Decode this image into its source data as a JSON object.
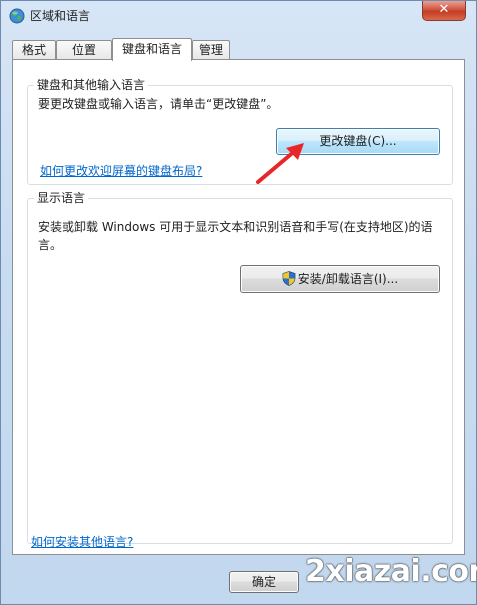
{
  "window": {
    "title": "区域和语言",
    "close_label": "✕"
  },
  "tabs": [
    {
      "label": "格式",
      "active": false
    },
    {
      "label": "位置",
      "active": false
    },
    {
      "label": "键盘和语言",
      "active": true
    },
    {
      "label": "管理",
      "active": false
    }
  ],
  "keyboard_group": {
    "title": "键盘和其他输入语言",
    "instruction": "要更改键盘或输入语言，请单击“更改键盘”。",
    "change_keyboard_button": "更改键盘(C)...",
    "welcome_screen_link": "如何更改欢迎屏幕的键盘布局?"
  },
  "display_group": {
    "title": "显示语言",
    "description_line1": "安装或卸载 Windows 可用于显示文本和识别语音和手写(在支持地区)的语",
    "description_line2": "言。",
    "install_button": "安装/卸载语言(I)..."
  },
  "footer": {
    "install_other_link": "如何安装其他语言?",
    "ok_button": "确定"
  },
  "watermark": "2xiazai.com",
  "colors": {
    "link": "#0066cc",
    "arrow": "#e8262a",
    "close_button": "#c43c22"
  }
}
